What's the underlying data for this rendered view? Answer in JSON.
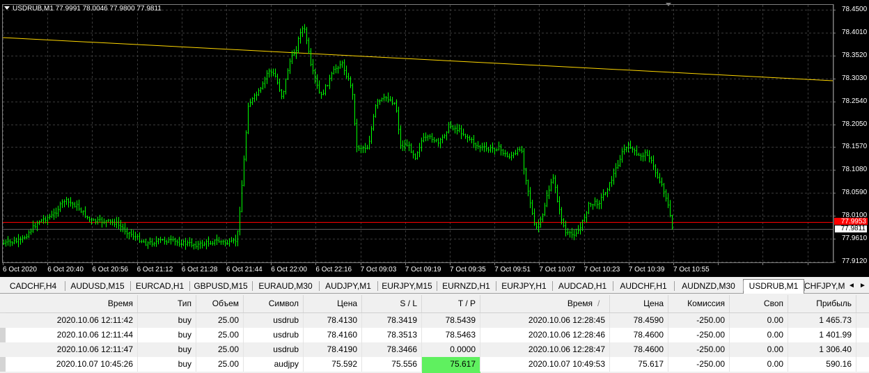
{
  "chart_title": "USDRUB,M1  77.9991 78.0046 77.9800 77.9811",
  "price_ticks": [
    "78.4500",
    "78.4010",
    "78.3520",
    "78.3030",
    "78.2540",
    "78.2050",
    "78.1570",
    "78.1080",
    "78.0590",
    "78.0100",
    "77.9610",
    "77.9120"
  ],
  "time_ticks": [
    "6 Oct 2020",
    "6 Oct 20:40",
    "6 Oct 20:56",
    "6 Oct 21:12",
    "6 Oct 21:28",
    "6 Oct 21:44",
    "6 Oct 22:00",
    "6 Oct 22:16",
    "7 Oct 09:03",
    "7 Oct 09:19",
    "7 Oct 09:35",
    "7 Oct 09:51",
    "7 Oct 10:07",
    "7 Oct 10:23",
    "7 Oct 10:39",
    "7 Oct 10:55"
  ],
  "red_line_price": "77.9953",
  "current_price": "77.9811",
  "colors": {
    "bars": "#00ff00",
    "trend_line": "#ffd700",
    "level_line": "#ff0000",
    "grid": "#3a3a3a"
  },
  "tabs": [
    "CADCHF,H4",
    "AUDUSD,M15",
    "EURCAD,H1",
    "GBPUSD,M15",
    "EURAUD,M30",
    "AUDJPY,M1",
    "EURJPY,M15",
    "EURNZD,H1",
    "EURJPY,H1",
    "AUDCAD,H1",
    "AUDCHF,H1",
    "AUDNZD,M30",
    "USDRUB,M1",
    "CHFJPY,M"
  ],
  "active_tab": "USDRUB,M1",
  "tab_nav": {
    "left": "◄",
    "right": "►"
  },
  "table": {
    "headers": [
      "Время",
      "Тип",
      "Объем",
      "Символ",
      "Цена",
      "S / L",
      "T / P",
      "Время",
      "Цена",
      "Комиссия",
      "Своп",
      "Прибыль"
    ],
    "sort_indicator": "/",
    "rows": [
      [
        "2020.10.06 12:11:42",
        "buy",
        "25.00",
        "usdrub",
        "78.4130",
        "78.3419",
        "78.5439",
        "2020.10.06 12:28:45",
        "78.4590",
        "-250.00",
        "0.00",
        "1 465.73"
      ],
      [
        "2020.10.06 12:11:44",
        "buy",
        "25.00",
        "usdrub",
        "78.4160",
        "78.3513",
        "78.5463",
        "2020.10.06 12:28:46",
        "78.4600",
        "-250.00",
        "0.00",
        "1 401.99"
      ],
      [
        "2020.10.06 12:11:47",
        "buy",
        "25.00",
        "usdrub",
        "78.4190",
        "78.3466",
        "0.0000",
        "2020.10.06 12:28:47",
        "78.4600",
        "-250.00",
        "0.00",
        "1 306.40"
      ],
      [
        "2020.10.07 10:45:26",
        "buy",
        "25.00",
        "audjpy",
        "75.592",
        "75.556",
        "75.617",
        "2020.10.07 10:49:53",
        "75.617",
        "-250.00",
        "0.00",
        "590.16"
      ]
    ]
  }
}
